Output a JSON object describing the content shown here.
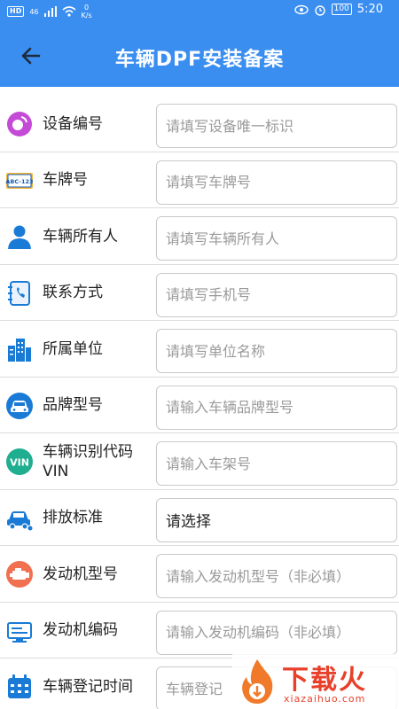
{
  "status_bar": {
    "hd": "HD",
    "signal": "46",
    "speed_value": "0",
    "speed_unit": "K/s",
    "battery": "100",
    "time": "5:20"
  },
  "header": {
    "title": "车辆DPF安装备案"
  },
  "form": {
    "rows": [
      {
        "label": "设备编号",
        "placeholder": "请填写设备唯一标识",
        "icon": "device-icon"
      },
      {
        "label": "车牌号",
        "placeholder": "请填写车牌号",
        "icon": "license-plate-icon",
        "plate_text": "ABC-123"
      },
      {
        "label": "车辆所有人",
        "placeholder": "请填写车辆所有人",
        "icon": "person-icon"
      },
      {
        "label": "联系方式",
        "placeholder": "请填写手机号",
        "icon": "contact-book-icon"
      },
      {
        "label": "所属单位",
        "placeholder": "请填写单位名称",
        "icon": "building-icon"
      },
      {
        "label": "品牌型号",
        "placeholder": "请输入车辆品牌型号",
        "icon": "car-icon"
      },
      {
        "label": "车辆识别代码VIN",
        "placeholder": "请输入车架号",
        "icon": "vin-icon",
        "vin_text": "VIN"
      },
      {
        "label": "排放标准",
        "value": "请选择",
        "icon": "car-emission-icon"
      },
      {
        "label": "发动机型号",
        "placeholder": "请输入发动机型号（非必填）",
        "icon": "engine-icon"
      },
      {
        "label": "发动机编码",
        "placeholder": "请输入发动机编码（非必填）",
        "icon": "engine-code-icon"
      },
      {
        "label": "车辆登记时间",
        "placeholder": "车辆登记",
        "icon": "calendar-icon"
      }
    ]
  },
  "watermark": {
    "brand": "下载火",
    "url": "xiazaihuo.com"
  },
  "colors": {
    "primary": "#3a8ef0",
    "label": "#222222",
    "placeholder": "#9a9a9a",
    "border": "#c9c9c9"
  }
}
